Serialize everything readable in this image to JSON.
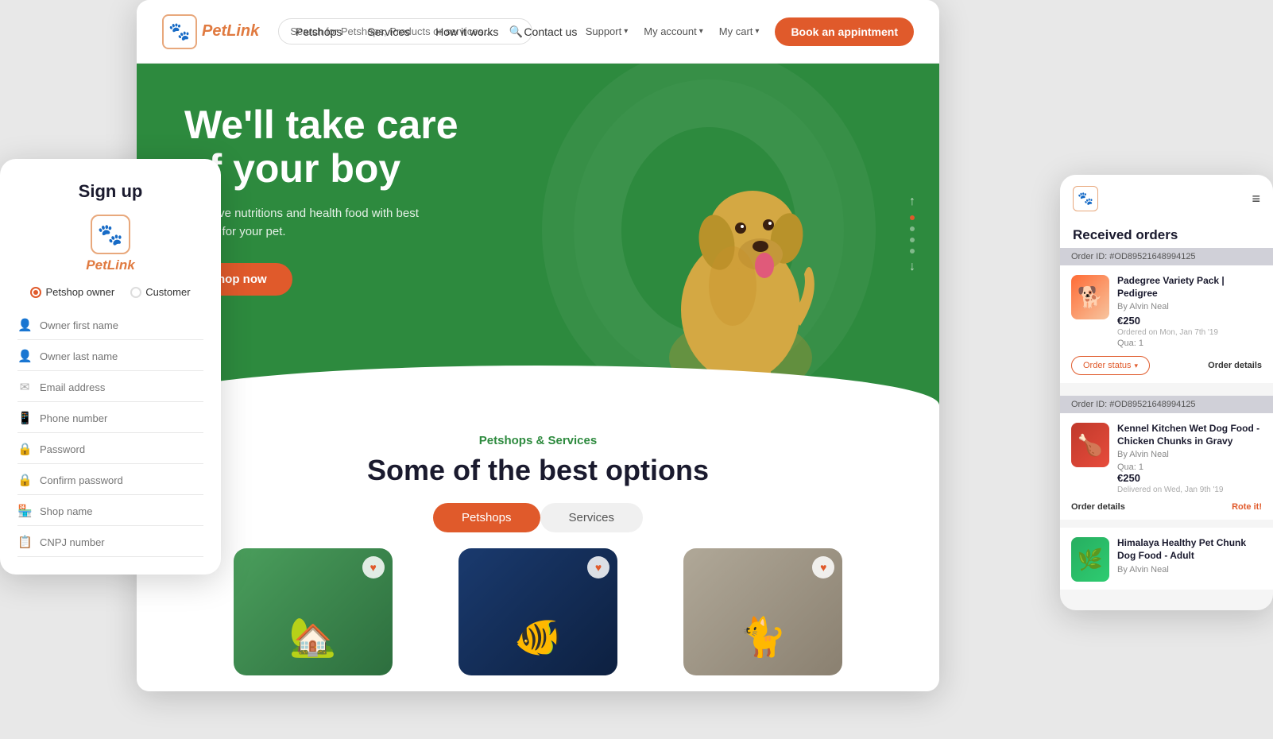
{
  "brand": {
    "name": "PetLink",
    "logo_emoji": "🐾"
  },
  "header": {
    "search_placeholder": "Search for Petshops, Products or services...",
    "nav_items": [
      {
        "label": "Petshops",
        "id": "petshops"
      },
      {
        "label": "Services",
        "id": "services"
      },
      {
        "label": "How it works",
        "id": "how-it-works"
      },
      {
        "label": "Contact us",
        "id": "contact-us"
      }
    ],
    "support_label": "Support",
    "my_account_label": "My account",
    "my_cart_label": "My cart",
    "book_btn_label": "Book an appintment"
  },
  "hero": {
    "title_line1": "We'll take care",
    "title_line2": "of your boy",
    "subtitle": "We have nutritions and health food with best quality for your pet.",
    "shop_btn_label": "Shop now"
  },
  "section": {
    "tag": "Petshops & Services",
    "title": "Some of the best options",
    "tabs": [
      {
        "label": "Petshops",
        "active": true
      },
      {
        "label": "Services",
        "active": false
      }
    ]
  },
  "products": [
    {
      "card_type": "green",
      "heart": "♥"
    },
    {
      "card_type": "blue",
      "heart": "♥"
    },
    {
      "card_type": "beige",
      "heart": "♥"
    }
  ],
  "signup": {
    "title": "Sign up",
    "logo_text": "PetLink",
    "logo_emoji": "🐾",
    "radio_options": [
      {
        "label": "Petshop owner",
        "selected": true
      },
      {
        "label": "Customer",
        "selected": false
      }
    ],
    "fields": [
      {
        "icon": "👤",
        "placeholder": "Owner first name",
        "type": "text"
      },
      {
        "icon": "👤",
        "placeholder": "Owner last name",
        "type": "text"
      },
      {
        "icon": "✉",
        "placeholder": "Email address",
        "type": "email"
      },
      {
        "icon": "📱",
        "placeholder": "Phone number",
        "type": "tel"
      },
      {
        "icon": "🔒",
        "placeholder": "Password",
        "type": "password"
      },
      {
        "icon": "🔒",
        "placeholder": "Confirm password",
        "type": "password"
      },
      {
        "icon": "🏪",
        "placeholder": "Shop name",
        "type": "text"
      },
      {
        "icon": "📋",
        "placeholder": "CNPJ number",
        "type": "text"
      }
    ]
  },
  "orders": {
    "title": "Received orders",
    "menu_icon": "≡",
    "items": [
      {
        "order_id": "Order ID: #OD89521648994125",
        "product_name": "Padegree Variety Pack | Pedigree",
        "by": "By Alvin Neal",
        "qty": "Qua: 1",
        "price": "€250",
        "date": "Ordered on Mon, Jan 7th '19",
        "status_btn": "Order status",
        "details_link": "Order details",
        "thumb_emoji": "🐕",
        "thumb_type": "1"
      },
      {
        "order_id": "Order ID: #OD89521648994125",
        "product_name": "Kennel Kitchen Wet Dog Food - Chicken Chunks in Gravy",
        "by": "By Alvin Neal",
        "qty": "Qua: 1",
        "price": "€250",
        "date": "Delivered on Wed, Jan 9th '19",
        "details_link": "Order details",
        "rate_link": "Rote it!",
        "thumb_emoji": "🍗",
        "thumb_type": "2"
      },
      {
        "order_id": "",
        "product_name": "Himalaya Healthy Pet Chunk Dog Food - Adult",
        "by": "By Alvin Neal",
        "thumb_emoji": "🌿",
        "thumb_type": "3"
      }
    ]
  }
}
